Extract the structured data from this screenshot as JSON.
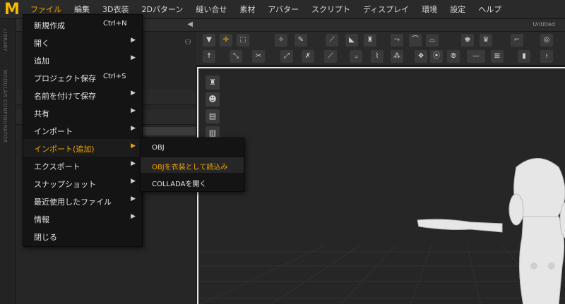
{
  "app": {
    "logo": "M",
    "document_title": "Untitled"
  },
  "menubar": {
    "items": [
      {
        "label": "ファイル",
        "active": true
      },
      {
        "label": "編集"
      },
      {
        "label": "3D衣装"
      },
      {
        "label": "2Dパターン"
      },
      {
        "label": "縫い合せ"
      },
      {
        "label": "素材"
      },
      {
        "label": "アバター"
      },
      {
        "label": "スクリプト"
      },
      {
        "label": "ディスプレイ"
      },
      {
        "label": "環境"
      },
      {
        "label": "設定"
      },
      {
        "label": "ヘルプ"
      }
    ]
  },
  "left_strip": {
    "library": "LIBRARY",
    "configurator": "MODULAR CONFIGURATOR"
  },
  "file_menu": {
    "items": [
      {
        "label": "新規作成",
        "shortcut": "Ctrl+N"
      },
      {
        "label": "開く",
        "submenu": "▶"
      },
      {
        "label": "追加",
        "submenu": "▶"
      },
      {
        "label": "プロジェクト保存",
        "shortcut": "Ctrl+S"
      },
      {
        "label": "名前を付けて保存",
        "submenu": "▶"
      },
      {
        "label": "共有",
        "submenu": "▶"
      },
      {
        "label": "インポート",
        "submenu": "▶"
      },
      {
        "label": "インポート(追加)",
        "submenu": "▶"
      },
      {
        "label": "エクスポート",
        "submenu": "▶"
      },
      {
        "label": "スナップショット",
        "submenu": "▶"
      },
      {
        "label": "最近使用したファイル",
        "submenu": "▶"
      },
      {
        "label": "情報",
        "submenu": "▶"
      },
      {
        "label": "閉じる"
      }
    ]
  },
  "import_add_submenu": {
    "items": [
      {
        "label": "OBJ"
      },
      {
        "label": "OBJを衣装として読込み"
      },
      {
        "label": "COLLADAを開く"
      }
    ]
  },
  "colors": {
    "accent": "#f0a400",
    "logo": "#f2b800",
    "viewport_border": "#e8e8e8"
  },
  "icons": {
    "toolbar": [
      "down-arrow-icon",
      "move-icon",
      "select-box-icon",
      "transform-icon",
      "edit-icon",
      "pin-icon",
      "fold-icon",
      "shirt-icon",
      "segment-icon",
      "hanger-icon",
      "tshirt-icon",
      "jacket-icon",
      "hook-icon",
      "ring-icon",
      "walk-icon",
      "tack-icon",
      "needle-icon",
      "stitch-icon",
      "cut-icon",
      "iron-icon",
      "brush-icon",
      "hang-icon",
      "pattern-icon",
      "button-icon",
      "buttonhole-icon",
      "zipper-icon",
      "lock-icon",
      "tape-icon",
      "measure-icon"
    ],
    "side": [
      "garment-icon",
      "avatar-icon",
      "layer-icon",
      "layer2-icon"
    ]
  }
}
